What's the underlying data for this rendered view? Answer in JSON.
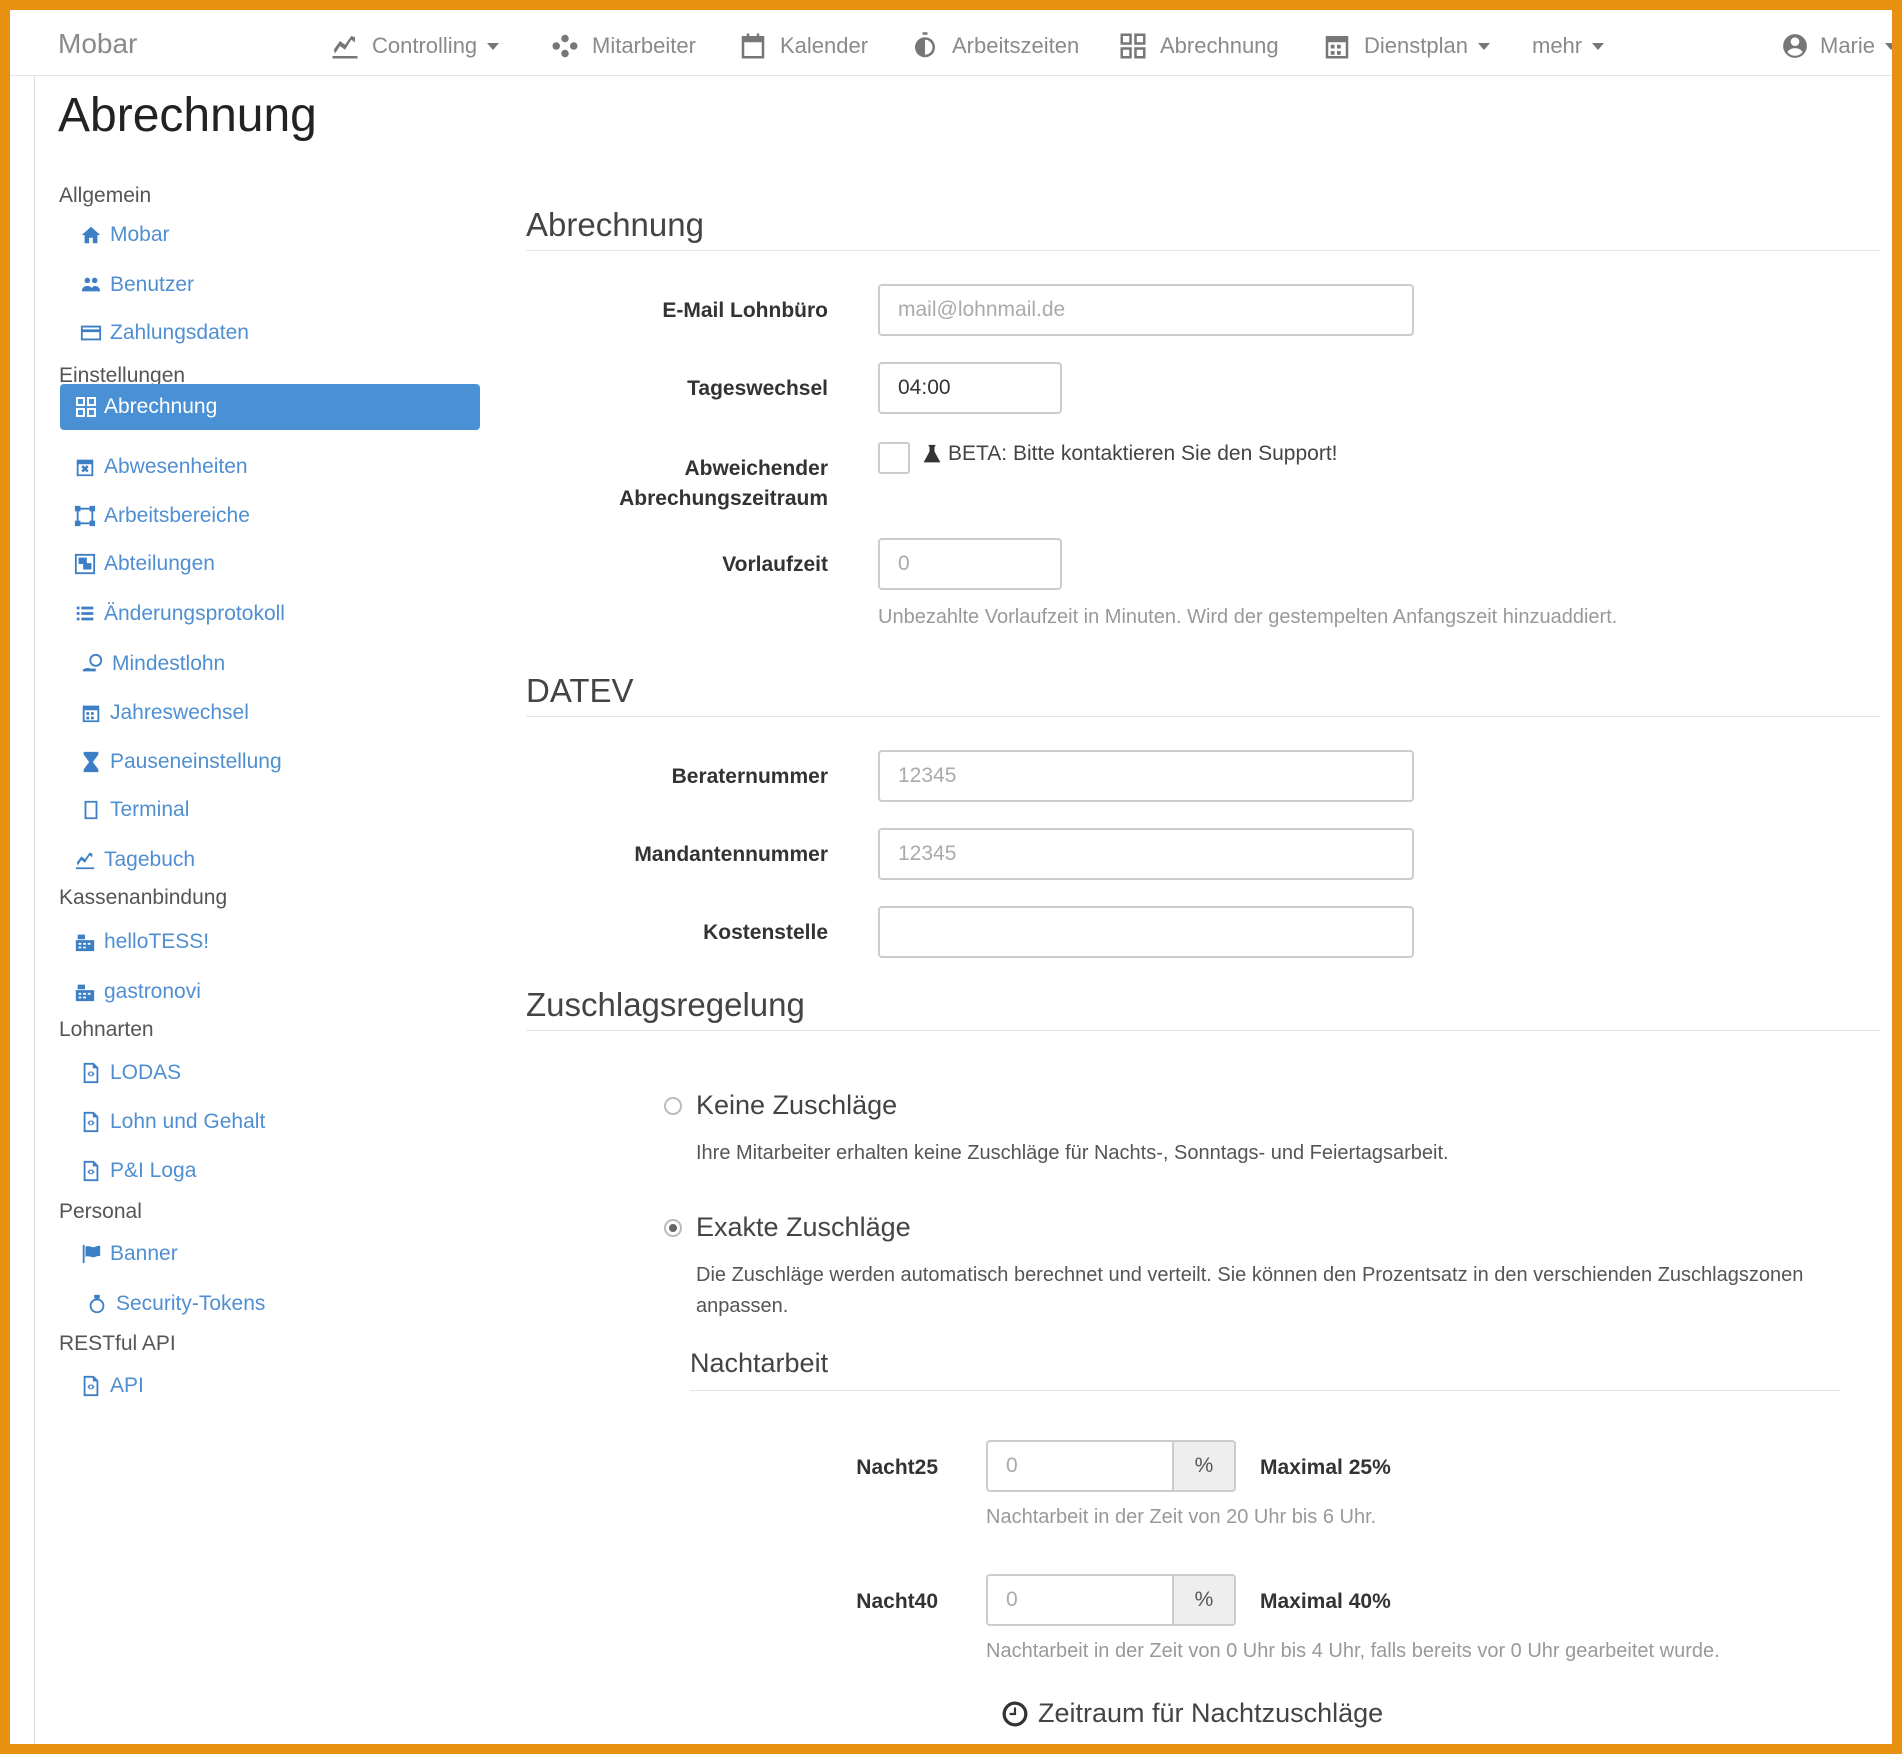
{
  "brand": "Mobar",
  "nav": {
    "controlling": "Controlling",
    "mitarbeiter": "Mitarbeiter",
    "kalender": "Kalender",
    "arbeitszeiten": "Arbeitszeiten",
    "abrechnung": "Abrechnung",
    "dienstplan": "Dienstplan",
    "mehr": "mehr",
    "user": "Marie"
  },
  "page_title": "Abrechnung",
  "sidebar": {
    "cat_allgemein": "Allgemein",
    "mobar": "Mobar",
    "benutzer": "Benutzer",
    "zahlungsdaten": "Zahlungsdaten",
    "cat_einstellungen": "Einstellungen",
    "abrechnung": "Abrechnung",
    "abwesenheiten": "Abwesenheiten",
    "arbeitsbereiche": "Arbeitsbereiche",
    "abteilungen": "Abteilungen",
    "aenderungsprotokoll": "Änderungsprotokoll",
    "mindestlohn": "Mindestlohn",
    "jahreswechsel": "Jahreswechsel",
    "pauseneinstellung": "Pauseneinstellung",
    "terminal": "Terminal",
    "tagebuch": "Tagebuch",
    "cat_kassen": "Kassenanbindung",
    "hellotess": "helloTESS!",
    "gastronovi": "gastronovi",
    "cat_lohnarten": "Lohnarten",
    "lodas": "LODAS",
    "lohn_gehalt": "Lohn und Gehalt",
    "pi_loga": "P&I Loga",
    "cat_personal": "Personal",
    "banner": "Banner",
    "security_tokens": "Security-Tokens",
    "cat_restful": "RESTful API",
    "api": "API"
  },
  "abrechnung": {
    "title": "Abrechnung",
    "email_label": "E-Mail Lohnbüro",
    "email_placeholder": "mail@lohnmail.de",
    "tageswechsel_label": "Tageswechsel",
    "tageswechsel_value": "04:00",
    "abweichender_label_1": "Abweichender",
    "abweichender_label_2": "Abrechungszeitraum",
    "beta_text": "BETA: Bitte kontaktieren Sie den Support!",
    "vorlaufzeit_label": "Vorlaufzeit",
    "vorlaufzeit_placeholder": "0",
    "vorlaufzeit_help": "Unbezahlte Vorlaufzeit in Minuten. Wird der gestempelten Anfangszeit hinzuaddiert."
  },
  "datev": {
    "title": "DATEV",
    "berater_label": "Beraternummer",
    "berater_placeholder": "12345",
    "mandanten_label": "Mandantennummer",
    "mandanten_placeholder": "12345",
    "kosten_label": "Kostenstelle",
    "kosten_value": ""
  },
  "zuschlag": {
    "title": "Zuschlagsregelung",
    "keine_label": "Keine Zuschläge",
    "keine_desc": "Ihre Mitarbeiter erhalten keine Zuschläge für Nachts-, Sonntags- und Feiertagsarbeit.",
    "exakte_label": "Exakte Zuschläge",
    "exakte_desc": "Die Zuschläge werden automatisch berechnet und verteilt. Sie können den Prozentsatz in den verschienden Zuschlagszonen anpassen.",
    "selected": "exakte"
  },
  "nachtarbeit": {
    "title": "Nachtarbeit",
    "n25_label": "Nacht25",
    "n25_placeholder": "0",
    "n25_unit": "%",
    "n25_max": "Maximal 25%",
    "n25_help": "Nachtarbeit in der Zeit von 20 Uhr bis 6 Uhr.",
    "n40_label": "Nacht40",
    "n40_placeholder": "0",
    "n40_unit": "%",
    "n40_max": "Maximal 40%",
    "n40_help": "Nachtarbeit in der Zeit von 0 Uhr bis 4 Uhr, falls bereits vor 0 Uhr gearbeitet wurde.",
    "zeitraum": "Zeitraum für Nachtzuschläge"
  },
  "colors": {
    "accent": "#4a90d4",
    "frame": "#e8900f"
  }
}
